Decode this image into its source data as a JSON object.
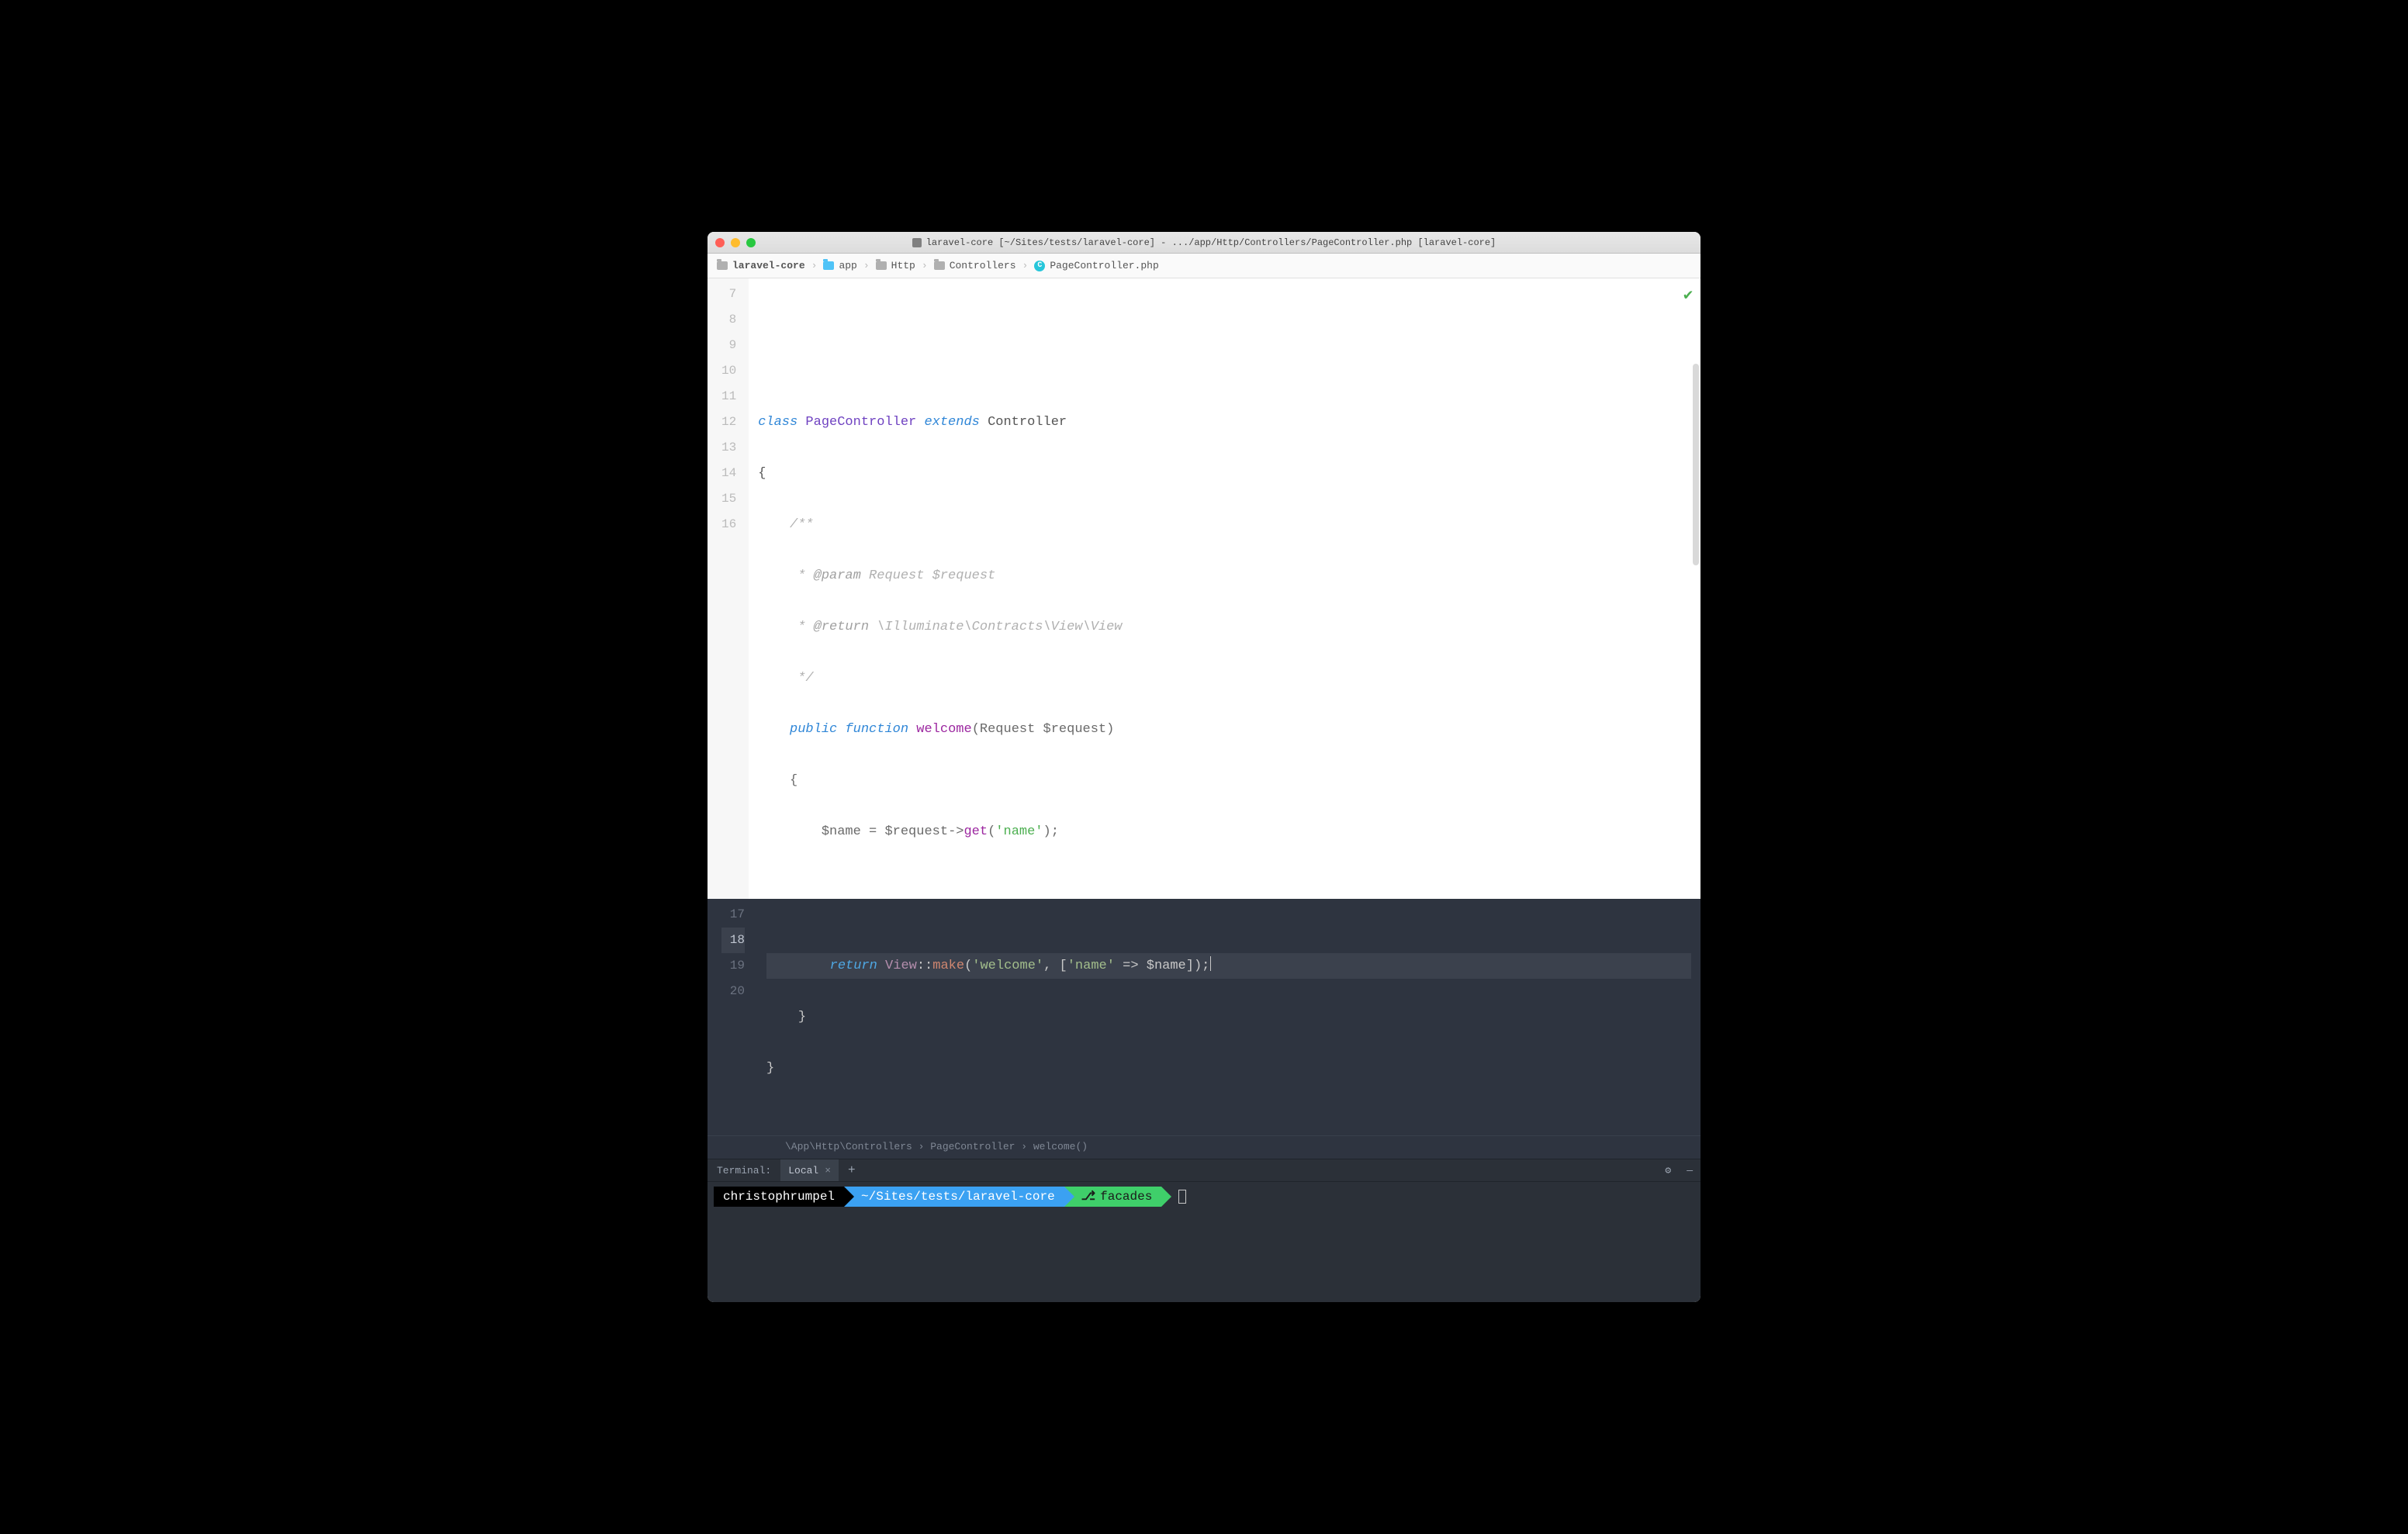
{
  "window": {
    "title": "laravel-core [~/Sites/tests/laravel-core] - .../app/Http/Controllers/PageController.php [laravel-core]"
  },
  "breadcrumbs": [
    {
      "label": "laravel-core",
      "icon": "folder-grey"
    },
    {
      "label": "app",
      "icon": "folder-blue"
    },
    {
      "label": "Http",
      "icon": "folder-grey"
    },
    {
      "label": "Controllers",
      "icon": "folder-grey"
    },
    {
      "label": "PageController.php",
      "icon": "class-c"
    }
  ],
  "editor": {
    "light_lines": [
      7,
      8,
      9,
      10,
      11,
      12,
      13,
      14,
      15,
      16
    ],
    "dark_lines": [
      17,
      18,
      19,
      20
    ],
    "current_line": 18,
    "code": {
      "l8": {
        "kw_class": "class",
        "name": "PageController",
        "kw_ext": "extends",
        "base": "Controller"
      },
      "l9": "{",
      "l10": "/**",
      "l11": {
        "star": " * ",
        "tag": "@param",
        "rest": " Request $request"
      },
      "l12": {
        "star": " * ",
        "tag": "@return",
        "rest": " \\Illuminate\\Contracts\\View\\View"
      },
      "l13": " */",
      "l14": {
        "vis": "public",
        "fn_kw": "function",
        "name": "welcome",
        "sig_open": "(Request ",
        "param": "$request",
        "sig_close": ")"
      },
      "l15": "{",
      "l16": {
        "var1": "$name",
        "eq": " = ",
        "var2": "$request",
        "arrow": "->",
        "call": "get",
        "open": "(",
        "str": "'name'",
        "close": ");"
      },
      "l18": {
        "ret": "return",
        "cls": "View",
        "cc": "::",
        "fn": "make",
        "open": "(",
        "str1": "'welcome'",
        "comma": ", [",
        "str2": "'name'",
        "arrow": " => ",
        "var": "$name",
        "close": "]);"
      },
      "l19": "}",
      "l20": "}"
    },
    "context_bar": "\\App\\Http\\Controllers › PageController › welcome()"
  },
  "terminal": {
    "label": "Terminal:",
    "tab": "Local",
    "prompt": {
      "user": "christophrumpel",
      "path": "~/Sites/tests/laravel-core",
      "branch": "facades"
    }
  }
}
